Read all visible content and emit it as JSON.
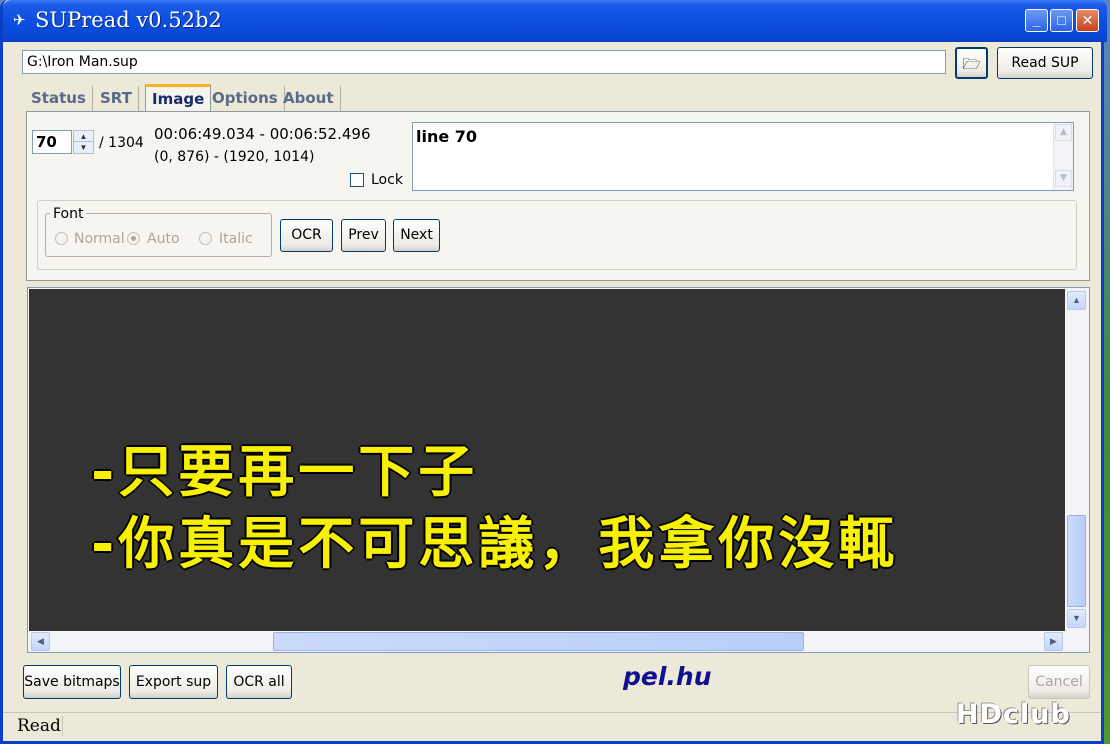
{
  "window": {
    "title": "SUPread v0.52b2",
    "minimize": "_",
    "maximize": "□",
    "close": "✕"
  },
  "file": {
    "path": "G:\\Iron Man.sup",
    "browse_icon": "folder-icon",
    "read_label": "Read SUP"
  },
  "tabs": [
    {
      "label": "Status"
    },
    {
      "label": "SRT"
    },
    {
      "label": "Image"
    },
    {
      "label": "Options"
    },
    {
      "label": "About"
    }
  ],
  "active_tab": "Image",
  "image_tab": {
    "current_index": "70",
    "total": "/ 1304",
    "time_range": "00:06:49.034 - 00:06:52.496",
    "coords": "(0, 876) - (1920, 1014)",
    "lock_label": "Lock",
    "lock_checked": false,
    "text": "line 70",
    "font_group": {
      "legend": "Font",
      "options": [
        {
          "label": "Normal",
          "selected": false
        },
        {
          "label": "Auto",
          "selected": true
        },
        {
          "label": "Italic",
          "selected": false
        }
      ]
    },
    "ocr_label": "OCR",
    "prev_label": "Prev",
    "next_label": "Next"
  },
  "subtitle_image": {
    "line1": "-只要再一下子",
    "line2": "-你真是不可思議，我拿你沒輒"
  },
  "bottom": {
    "save_bitmaps": "Save bitmaps",
    "export_sup": "Export sup",
    "ocr_all": "OCR all",
    "brand": "pel.hu",
    "cancel": "Cancel"
  },
  "status": "Read",
  "watermark": "HDclub",
  "colors": {
    "subtitle_text": "#f7f000",
    "canvas_bg": "#333333",
    "titlebar": "#0a48d6",
    "active_tab_accent": "#f5b02a"
  }
}
